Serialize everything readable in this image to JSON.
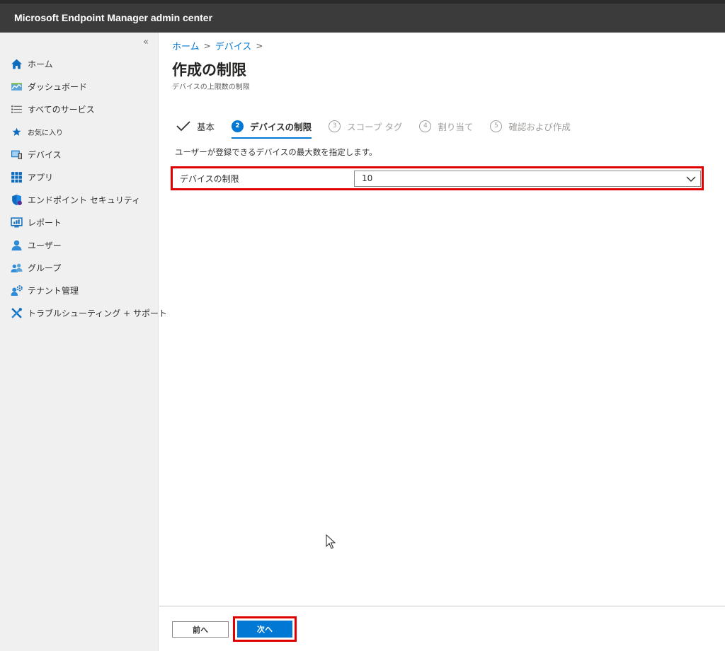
{
  "app": {
    "title": "Microsoft Endpoint Manager admin center"
  },
  "sidebar": {
    "collapse_glyph": "«",
    "items": [
      {
        "label": "ホーム",
        "icon": "home-icon"
      },
      {
        "label": "ダッシュボード",
        "icon": "dashboard-icon"
      },
      {
        "label": "すべてのサービス",
        "icon": "list-icon"
      },
      {
        "label": "お気に入り",
        "icon": "star-icon"
      },
      {
        "label": "デバイス",
        "icon": "devices-icon"
      },
      {
        "label": "アプリ",
        "icon": "apps-icon"
      },
      {
        "label": "エンドポイント セキュリティ",
        "icon": "shield-icon"
      },
      {
        "label": "レポート",
        "icon": "reports-icon"
      },
      {
        "label": "ユーザー",
        "icon": "user-icon"
      },
      {
        "label": "グループ",
        "icon": "group-icon"
      },
      {
        "label": "テナント管理",
        "icon": "tenant-icon"
      },
      {
        "label": "トラブルシューティング + サポート",
        "icon": "tools-icon"
      }
    ]
  },
  "breadcrumb": {
    "home": "ホーム",
    "devices": "デバイス",
    "separator": ">"
  },
  "page": {
    "title": "作成の制限",
    "subtitle": "デバイスの上限数の制限",
    "instruction": "ユーザーが登録できるデバイスの最大数を指定します。"
  },
  "steps": [
    {
      "label": "基本",
      "state": "done"
    },
    {
      "number": "2",
      "label": "デバイスの制限",
      "state": "current"
    },
    {
      "number": "3",
      "label": "スコープ タグ",
      "state": "future"
    },
    {
      "number": "4",
      "label": "割り当て",
      "state": "future"
    },
    {
      "number": "5",
      "label": "確認および作成",
      "state": "future"
    }
  ],
  "form": {
    "device_limit_label": "デバイスの制限",
    "device_limit_value": "10"
  },
  "footer": {
    "prev_label": "前へ",
    "next_label": "次へ"
  },
  "colors": {
    "accent": "#0078d4",
    "highlight": "#e00000",
    "topbar": "#3b3b3b",
    "sidebar": "#f0f0f0"
  }
}
